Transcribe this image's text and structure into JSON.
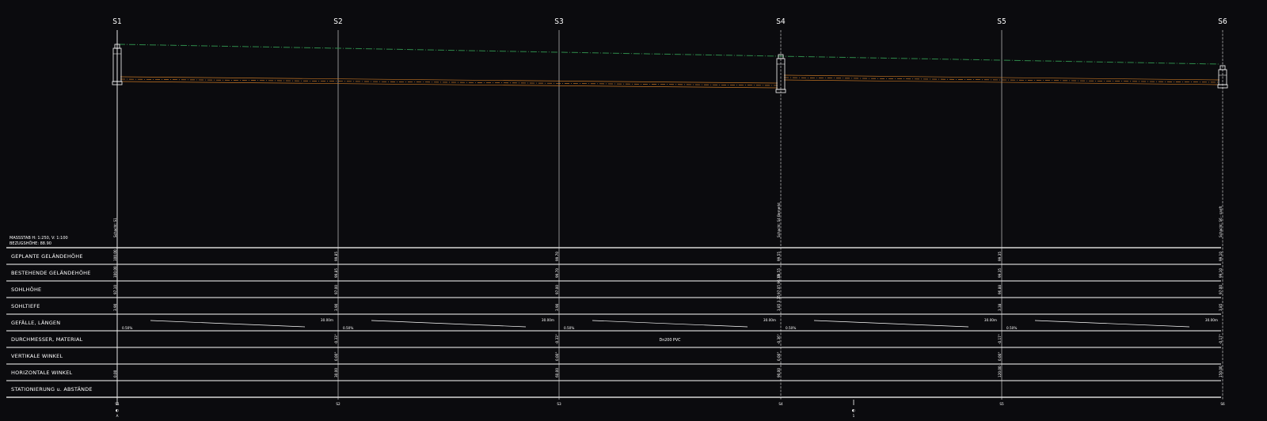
{
  "header": {
    "scale_label": "MASSSTAB H: 1:250, V: 1:100",
    "reference_label": "BEZUGSHÖHE: 88.90"
  },
  "stations": [
    {
      "name": "S1",
      "note": "Schacht: S1",
      "values": [
        "100.00",
        "100.00",
        "97.10",
        "3.90",
        "",
        "",
        "",
        "0.00"
      ],
      "bottom": "S1"
    },
    {
      "name": "S2",
      "note": "",
      "values": [
        "99.85",
        "99.85",
        "97.00",
        "3.90",
        "",
        "-0.33°",
        "0.00°",
        "30.00"
      ],
      "bottom": "S2"
    },
    {
      "name": "S3",
      "note": "",
      "values": [
        "99.70",
        "99.70",
        "97.00",
        "3.90",
        "",
        "-0.33°",
        "0.00°",
        "60.00"
      ],
      "bottom": "S3"
    },
    {
      "name": "S4",
      "note": "Schacht: S4 Bemerkt",
      "values": [
        "99.55",
        "99.55",
        "97.05 96.15",
        "3.85 3.35",
        "",
        "-0.36°",
        "0.00°",
        "90.00"
      ],
      "bottom": "S4"
    },
    {
      "name": "S5",
      "note": "",
      "values": [
        "99.35",
        "99.35",
        "96.88",
        "3.38",
        "",
        "-0.17°",
        "0.00°",
        "120.00"
      ],
      "bottom": "S5"
    },
    {
      "name": "S6",
      "note": "Schacht: S6 - sanft",
      "values": [
        "99.10",
        "99.10",
        "97.00",
        "3.85",
        "",
        "-0.17°",
        "",
        "150.00"
      ],
      "bottom": "S6"
    }
  ],
  "rows": [
    "GEPLANTE GELÄNDEHÖHE",
    "BESTEHENDE GELÄNDEHÖHE",
    "SOHLHÖHE",
    "SOHLTIEFE",
    "GEFÄLLE, LÄNGEN",
    "DURCHMESSER, MATERIAL",
    "VERTIKALE WINKEL",
    "HORIZONTALE WINKEL",
    "STATIONIERUNG u. ABSTÄNDE"
  ],
  "segments": [
    {
      "slope": "0.50%",
      "length": "30.00m"
    },
    {
      "slope": "0.50%",
      "length": "30.00m"
    },
    {
      "slope": "0.50%",
      "length": "30.00m"
    },
    {
      "slope": "0.50%",
      "length": "30.00m"
    },
    {
      "slope": "0.50%",
      "length": "30.00m"
    }
  ],
  "pipe_label": "Dn200 PVC",
  "markers": [
    {
      "symbol": "◐",
      "sub": "A"
    },
    {
      "symbol": "◐",
      "sub": "1"
    }
  ],
  "colors": {
    "background": "#0b0b0e",
    "terrain_line": "#2e8a4a",
    "pipe_line": "#c27424",
    "grid": "#ffffff"
  }
}
